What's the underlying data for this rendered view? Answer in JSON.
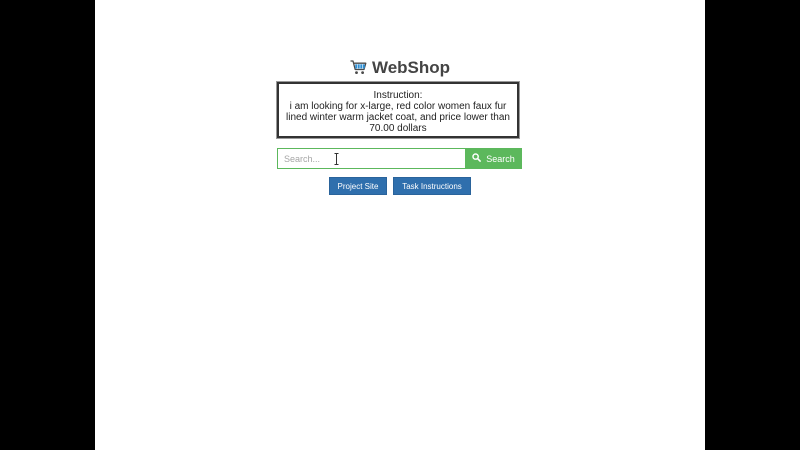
{
  "app": {
    "title": "WebShop"
  },
  "instruction": {
    "label": "Instruction:",
    "text": "i am looking for x-large, red color women faux fur lined winter warm jacket coat, and price lower than 70.00 dollars"
  },
  "search": {
    "placeholder": "Search...",
    "value": "",
    "button_label": "Search"
  },
  "links": {
    "project_site": "Project Site",
    "task_instructions": "Task Instructions"
  },
  "colors": {
    "search_green": "#5cb85c",
    "button_blue": "#2f6fad"
  },
  "icons": {
    "title": "cart-icon",
    "search_button": "search-icon",
    "mouse_cursor": "ibeam-cursor-icon"
  }
}
